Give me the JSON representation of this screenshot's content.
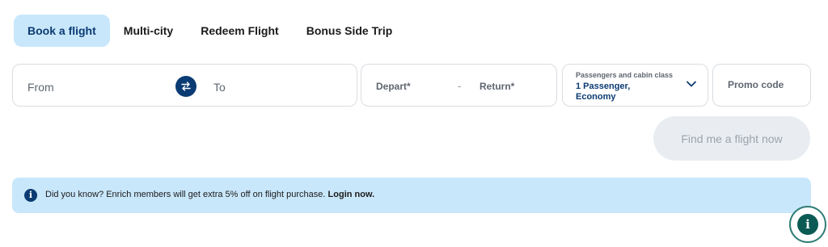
{
  "tabs": [
    {
      "label": "Book a flight",
      "active": true
    },
    {
      "label": "Multi-city",
      "active": false
    },
    {
      "label": "Redeem Flight",
      "active": false
    },
    {
      "label": "Bonus Side Trip",
      "active": false
    }
  ],
  "route": {
    "from_label": "From",
    "to_label": "To",
    "swap_icon": "swap-arrows-icon"
  },
  "dates": {
    "depart_label": "Depart*",
    "separator": "-",
    "return_label": "Return*"
  },
  "passengers": {
    "label": "Passengers and cabin class",
    "value": "1 Passenger, Economy",
    "icon": "chevron-down-icon"
  },
  "promo": {
    "placeholder": "Promo code",
    "value": ""
  },
  "find_button": {
    "label": "Find me a flight now"
  },
  "info": {
    "icon": "info-icon",
    "text": "Did you know? Enrich members will get extra 5% off on flight purchase.",
    "link_label": "Login now."
  },
  "help_button": {
    "icon": "info-icon"
  },
  "colors": {
    "primary": "#0b3b73",
    "active_tab_bg": "#c9e7fb",
    "info_bg": "#c9e7fb",
    "disabled_button_bg": "#e9edf1",
    "help_accent": "#2f7d76"
  }
}
